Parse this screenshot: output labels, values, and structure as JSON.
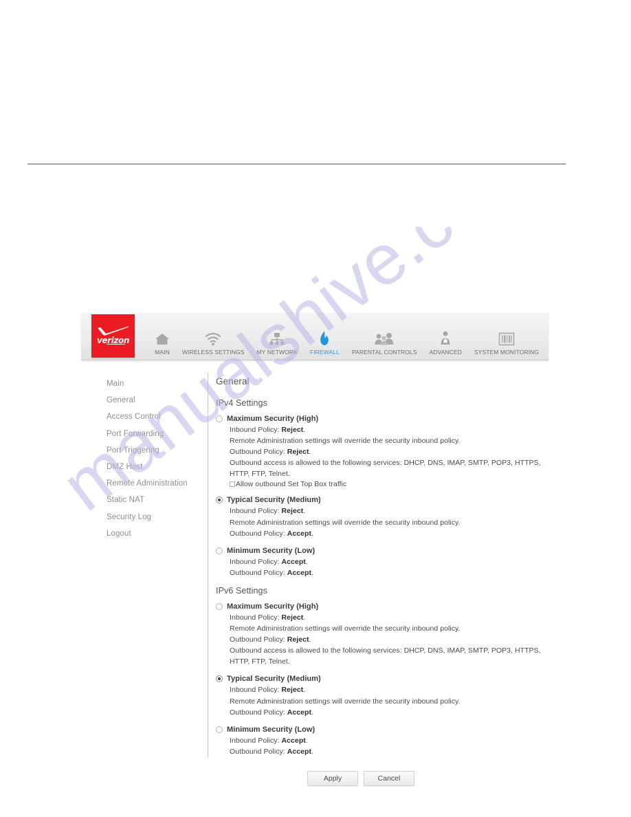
{
  "watermark": {
    "text": "manualshive.com"
  },
  "nav": {
    "logo_text": "verizon",
    "items": [
      {
        "label": "MAIN",
        "icon": "home-icon",
        "active": false
      },
      {
        "label": "WIRELESS SETTINGS",
        "icon": "wifi-icon",
        "active": false
      },
      {
        "label": "MY NETWORK",
        "icon": "network-icon",
        "active": false
      },
      {
        "label": "FIREWALL",
        "icon": "flame-icon",
        "active": true
      },
      {
        "label": "PARENTAL CONTROLS",
        "icon": "people-icon",
        "active": false
      },
      {
        "label": "ADVANCED",
        "icon": "person-gear-icon",
        "active": false
      },
      {
        "label": "SYSTEM MONITORING",
        "icon": "barcode-icon",
        "active": false
      }
    ]
  },
  "sidebar": {
    "items": [
      {
        "label": "Main"
      },
      {
        "label": "General"
      },
      {
        "label": "Access Control"
      },
      {
        "label": "Port Forwarding"
      },
      {
        "label": "Port Triggering"
      },
      {
        "label": "DMZ Host"
      },
      {
        "label": "Remote Administration"
      },
      {
        "label": "Static NAT"
      },
      {
        "label": "Security Log"
      },
      {
        "label": "Logout"
      }
    ]
  },
  "main": {
    "page_title": "General",
    "ipv4": {
      "title": "IPv4 Settings",
      "options": [
        {
          "label": "Maximum Security (High)",
          "selected": false,
          "lines": [
            {
              "prefix": "Inbound Policy: ",
              "strong": "Reject",
              "suffix": "."
            },
            {
              "prefix": "Remote Administration settings will override the security inbound policy.",
              "strong": "",
              "suffix": ""
            },
            {
              "prefix": "Outbound Policy: ",
              "strong": "Reject",
              "suffix": "."
            },
            {
              "prefix": "Outbound access is allowed to the following services: DHCP, DNS, IMAP, SMTP, POP3, HTTPS, HTTP, FTP, Telnet.",
              "strong": "",
              "suffix": ""
            }
          ],
          "checkbox": {
            "label": "Allow outbound Set Top Box traffic",
            "checked": false
          }
        },
        {
          "label": "Typical Security (Medium)",
          "selected": true,
          "lines": [
            {
              "prefix": "Inbound Policy: ",
              "strong": "Reject",
              "suffix": "."
            },
            {
              "prefix": "Remote Administration settings will override the security inbound policy.",
              "strong": "",
              "suffix": ""
            },
            {
              "prefix": "Outbound Policy: ",
              "strong": "Accept",
              "suffix": "."
            }
          ],
          "checkbox": null
        },
        {
          "label": "Minimum Security (Low)",
          "selected": false,
          "lines": [
            {
              "prefix": "Inbound Policy: ",
              "strong": "Accept",
              "suffix": "."
            },
            {
              "prefix": "Outbound Policy: ",
              "strong": "Accept",
              "suffix": "."
            }
          ],
          "checkbox": null
        }
      ]
    },
    "ipv6": {
      "title": "IPv6 Settings",
      "options": [
        {
          "label": "Maximum Security (High)",
          "selected": false,
          "lines": [
            {
              "prefix": "Inbound Policy: ",
              "strong": "Reject",
              "suffix": "."
            },
            {
              "prefix": "Remote Administration settings will override the security inbound policy.",
              "strong": "",
              "suffix": ""
            },
            {
              "prefix": "Outbound Policy: ",
              "strong": "Reject",
              "suffix": "."
            },
            {
              "prefix": "Outbound access is allowed to the following services: DHCP, DNS, IMAP, SMTP, POP3, HTTPS, HTTP, FTP, Telnet.",
              "strong": "",
              "suffix": ""
            }
          ],
          "checkbox": null
        },
        {
          "label": "Typical Security (Medium)",
          "selected": true,
          "lines": [
            {
              "prefix": "Inbound Policy: ",
              "strong": "Reject",
              "suffix": "."
            },
            {
              "prefix": "Remote Administration settings will override the security inbound policy.",
              "strong": "",
              "suffix": ""
            },
            {
              "prefix": "Outbound Policy: ",
              "strong": "Accept",
              "suffix": "."
            }
          ],
          "checkbox": null
        },
        {
          "label": "Minimum Security (Low)",
          "selected": false,
          "lines": [
            {
              "prefix": "Inbound Policy: ",
              "strong": "Accept",
              "suffix": "."
            },
            {
              "prefix": "Outbound Policy: ",
              "strong": "Accept",
              "suffix": "."
            }
          ],
          "checkbox": null
        }
      ]
    },
    "buttons": {
      "apply_label": "Apply",
      "cancel_label": "Cancel"
    }
  },
  "colors": {
    "verizon_red": "#ed1c24",
    "active_nav": "#3399dd",
    "nav_label": "#6d6d6d",
    "sidebar_text": "#8d8d8d",
    "watermark": "#b9b7e6"
  }
}
